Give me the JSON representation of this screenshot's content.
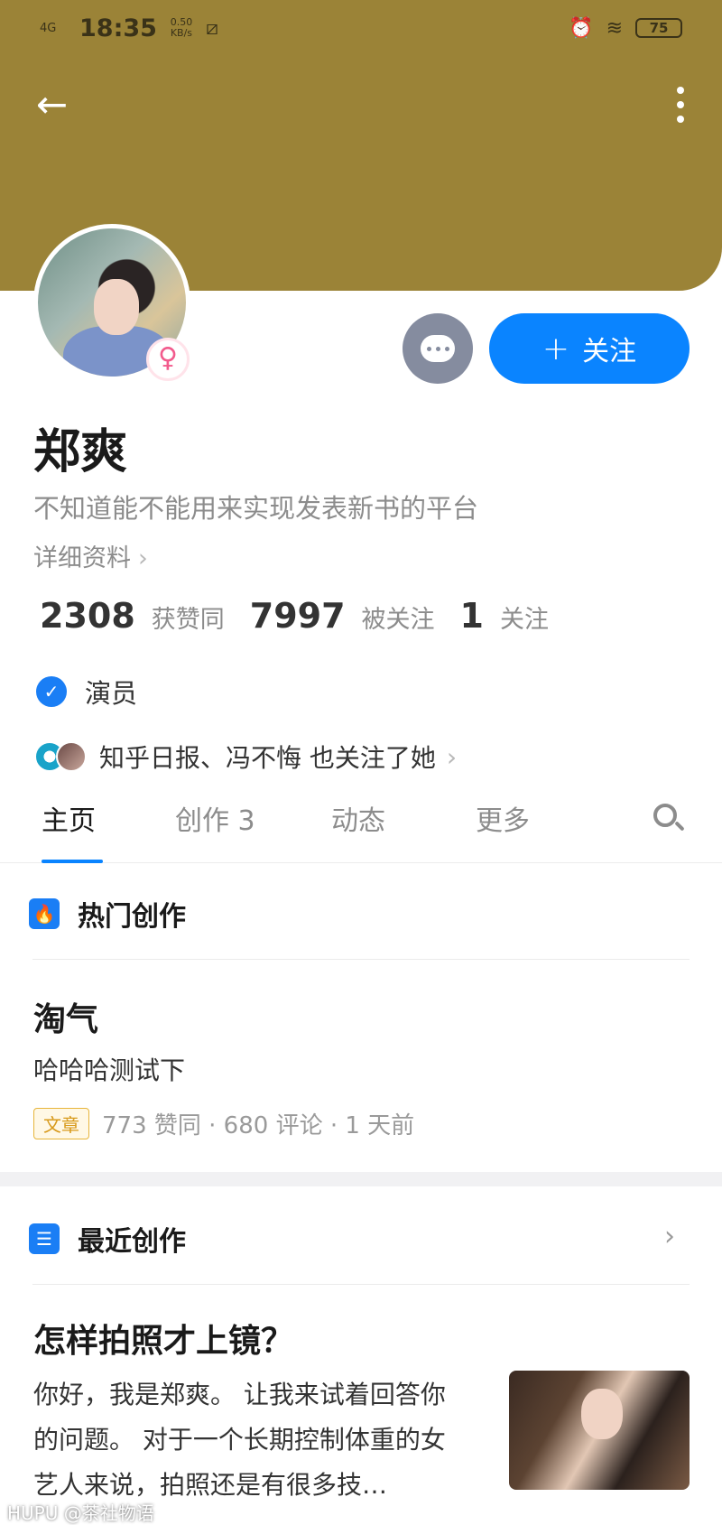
{
  "status_bar": {
    "signal": "4G",
    "time": "18:35",
    "net_speed": "0.50 KB/s",
    "battery": "75"
  },
  "colors": {
    "banner": "#9b8337",
    "accent": "#0a84ff",
    "gender": "#f25a8c"
  },
  "profile": {
    "name": "郑爽",
    "bio": "不知道能不能用来实现发表新书的平台",
    "detail_link": "详细资料",
    "gender_icon": "♀",
    "follow_label": "关注",
    "stats": [
      {
        "num": "2308",
        "label": "获赞同"
      },
      {
        "num": "7997",
        "label": "被关注"
      },
      {
        "num": "1",
        "label": "关注"
      }
    ],
    "verified_label": "演员",
    "mutual_text": "知乎日报、冯不悔 也关注了她"
  },
  "tabs": [
    {
      "label": "主页"
    },
    {
      "label": "创作 3"
    },
    {
      "label": "动态"
    },
    {
      "label": "更多"
    }
  ],
  "hot": {
    "section_title": "热门创作",
    "title": "淘气",
    "excerpt": "哈哈哈测试下",
    "tag": "文章",
    "meta": "773 赞同 · 680 评论 · 1 天前"
  },
  "recent": {
    "section_title": "最近创作",
    "title": "怎样拍照才上镜？",
    "excerpt": "你好，我是郑爽。 让我来试着回答你的问题。 对于一个长期控制体重的女艺人来说，拍照还是有很多技…"
  },
  "watermark": "HUPU @茶社物语"
}
